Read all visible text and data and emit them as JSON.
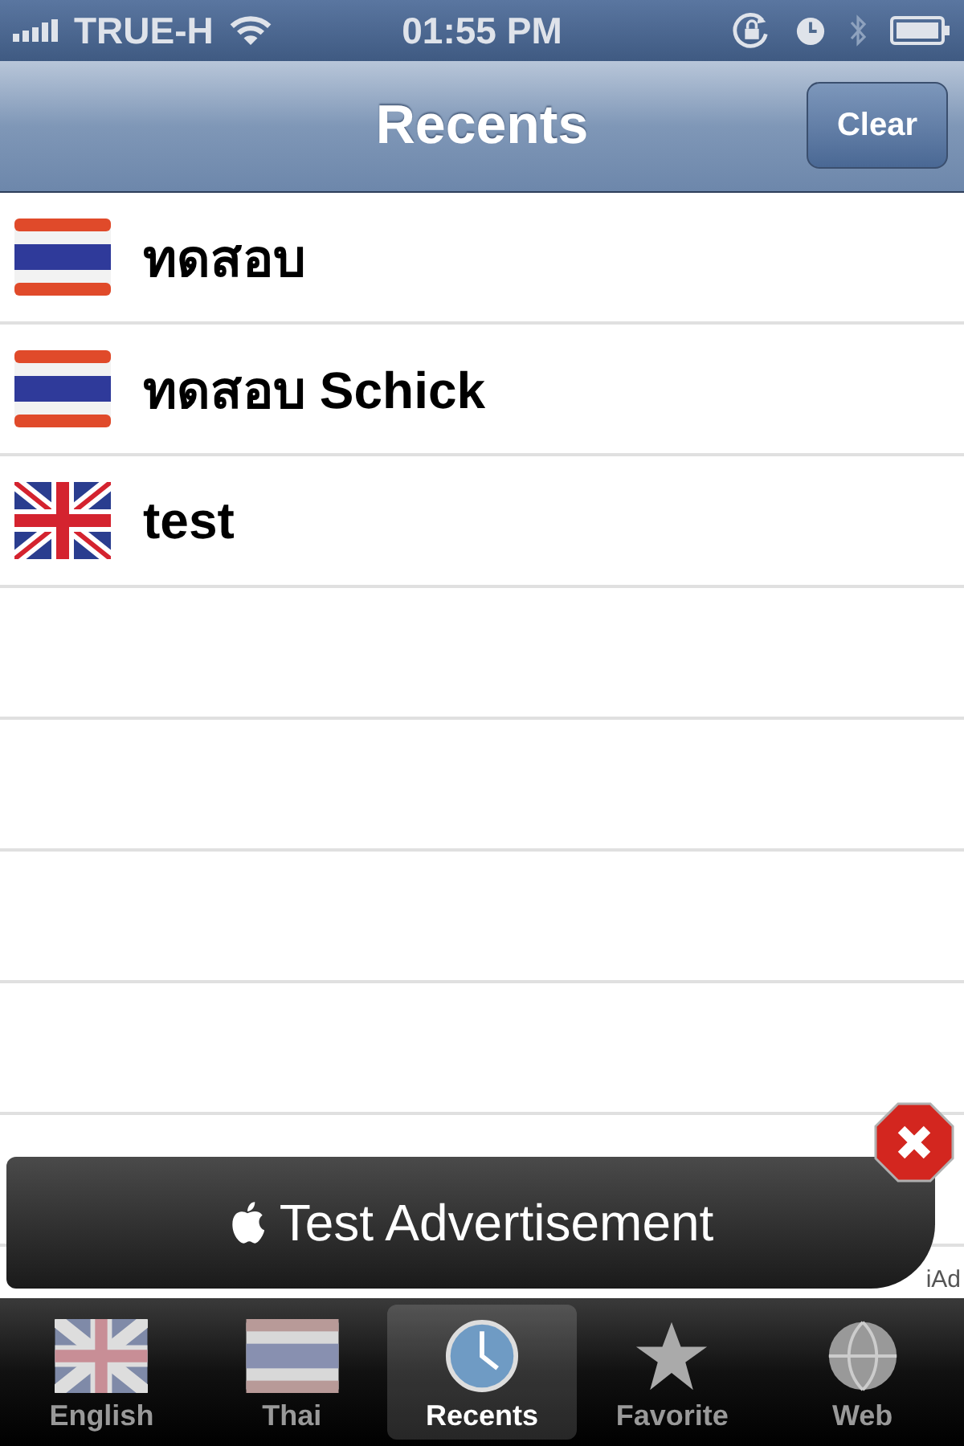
{
  "status_bar": {
    "carrier": "TRUE-H",
    "time": "01:55 PM"
  },
  "nav_bar": {
    "title": "Recents",
    "button": "Clear"
  },
  "recents": [
    {
      "kind": "thai",
      "text": "ทดสอบ"
    },
    {
      "kind": "thai",
      "text": "ทดสอบ Schick"
    },
    {
      "kind": "uk",
      "text": "test"
    }
  ],
  "ad": {
    "text": "Test Advertisement",
    "brand": "iAd"
  },
  "tabs": [
    {
      "label": "English",
      "kind": "uk",
      "selected": false
    },
    {
      "label": "Thai",
      "kind": "thai",
      "selected": false
    },
    {
      "label": "Recents",
      "kind": "clock",
      "selected": true
    },
    {
      "label": "Favorite",
      "kind": "star",
      "selected": false
    },
    {
      "label": "Web",
      "kind": "globe",
      "selected": false
    }
  ]
}
